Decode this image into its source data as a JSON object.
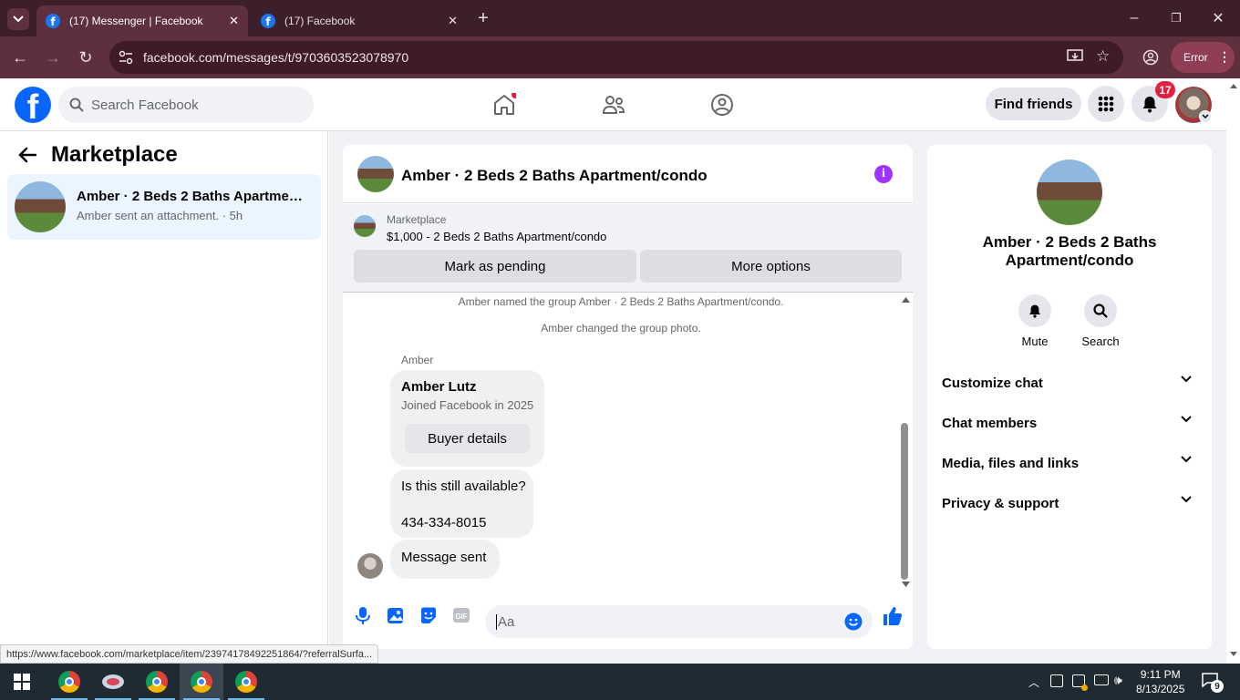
{
  "browser": {
    "tabs": [
      {
        "title": "(17) Messenger | Facebook",
        "active": true
      },
      {
        "title": "(17) Facebook",
        "active": false
      }
    ],
    "url": "facebook.com/messages/t/9703603523078970",
    "error_label": "Error"
  },
  "fb": {
    "search_placeholder": "Search Facebook",
    "find_friends": "Find friends",
    "notification_count": "17"
  },
  "left": {
    "title": "Marketplace",
    "conversation": {
      "title": "Amber · 2 Beds 2 Baths Apartment/condo",
      "subtitle": "Amber sent an attachment. · 5h"
    }
  },
  "chat": {
    "title": "Amber · 2 Beds 2 Baths Apartment/condo",
    "listing": {
      "label": "Marketplace",
      "price_title": "$1,000 - 2 Beds 2 Baths Apartment/condo",
      "mark_pending": "Mark as pending",
      "more_options": "More options"
    },
    "system_messages": [
      "Amber named the group Amber · 2 Beds 2 Baths Apartment/condo.",
      "Amber changed the group photo."
    ],
    "sender": "Amber",
    "profile_card": {
      "name": "Amber Lutz",
      "joined": "Joined Facebook in 2025",
      "button": "Buyer details"
    },
    "message_lines": [
      "Is this still available?",
      "434-334-8015"
    ],
    "message_sent": "Message sent",
    "input_placeholder": "Aa"
  },
  "right": {
    "title": "Amber · 2 Beds 2 Baths Apartment/condo",
    "actions": [
      "Mute",
      "Search"
    ],
    "sections": [
      "Customize chat",
      "Chat members",
      "Media, files and links",
      "Privacy & support"
    ]
  },
  "status_url": "https://www.facebook.com/marketplace/item/23974178492251864/?referralSurfa...",
  "taskbar": {
    "time": "9:11 PM",
    "date": "8/13/2025",
    "notification_count": "9"
  },
  "colors": {
    "fb_blue": "#0866ff",
    "messenger_purple": "#a033ff",
    "browser_frame": "#5e2f3c"
  }
}
